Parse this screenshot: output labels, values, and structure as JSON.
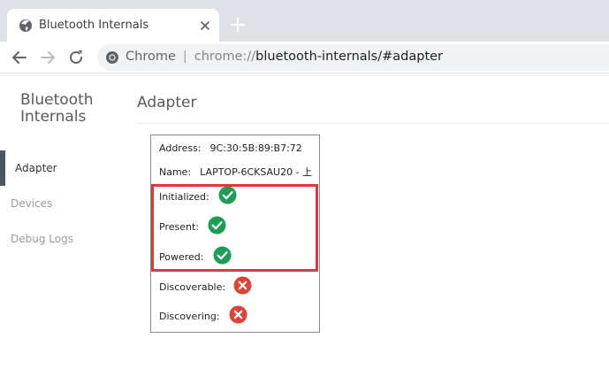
{
  "browser": {
    "tab": {
      "title": "Bluetooth Internals",
      "favicon": "globe-icon"
    },
    "omnibox": {
      "site_label": "Chrome",
      "separator": "|",
      "url_scheme": "chrome://",
      "url_rest": "bluetooth-internals/#adapter"
    }
  },
  "sidebar": {
    "title": "Bluetooth Internals",
    "items": [
      {
        "label": "Adapter",
        "selected": true
      },
      {
        "label": "Devices",
        "selected": false
      },
      {
        "label": "Debug Logs",
        "selected": false
      }
    ]
  },
  "main": {
    "title": "Adapter",
    "adapter": {
      "address_label": "Address:",
      "address_value": "9C:30:5B:89:B7:72",
      "name_label": "Name:",
      "name_value": "LAPTOP-6CKSAU20 - 上",
      "states": [
        {
          "label": "Initialized:",
          "status": "true",
          "icon": "check-circle-icon"
        },
        {
          "label": "Present:",
          "status": "true",
          "icon": "check-circle-icon"
        },
        {
          "label": "Powered:",
          "status": "true",
          "icon": "check-circle-icon"
        },
        {
          "label": "Discoverable:",
          "status": "false",
          "icon": "x-circle-icon"
        },
        {
          "label": "Discovering:",
          "status": "false",
          "icon": "x-circle-icon"
        }
      ]
    }
  },
  "colors": {
    "success": "#1e9e55",
    "error": "#db4437",
    "highlight": "#e3363a",
    "tabstrip": "#dee1e6"
  }
}
